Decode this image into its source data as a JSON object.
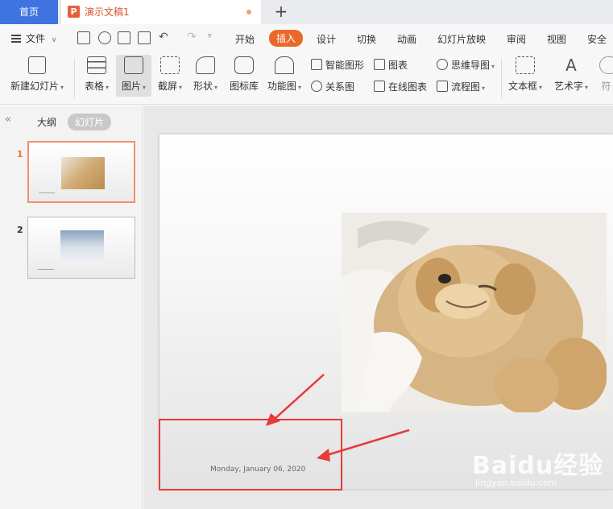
{
  "tabs": {
    "home_label": "首页",
    "doc_icon_glyph": "P",
    "doc_title": "演示文稿1",
    "new_tab_glyph": "+"
  },
  "menu": {
    "file_label": "文件",
    "items": [
      "开始",
      "插入",
      "设计",
      "切换",
      "动画",
      "幻灯片放映",
      "审阅",
      "视图",
      "安全"
    ],
    "active_index": 1,
    "accent_color": "#e9682a"
  },
  "ribbon": {
    "new_slide": "新建幻灯片",
    "table": "表格",
    "picture": "图片",
    "screenshot": "截屏",
    "shape": "形状",
    "icon_lib": "图标库",
    "func_chart": "功能图",
    "smart_shape": "智能图形",
    "chart": "图表",
    "relation": "关系图",
    "online_chart": "在线图表",
    "mindmap": "思维导图",
    "flowchart": "流程图",
    "textbox": "文本框",
    "wordart": "艺术字",
    "symbol_partial": "符"
  },
  "panel": {
    "collapse_glyph": "«",
    "outline_tab": "大纲",
    "slides_tab": "幻灯片",
    "thumbnails": [
      {
        "number": "1",
        "selected": true,
        "image": "sleeping-golden-puppy"
      },
      {
        "number": "2",
        "selected": false,
        "image": "white-fluffy-puppy-in-snow"
      }
    ]
  },
  "slide": {
    "image": "sleeping-golden-puppy-photo",
    "footer_date": "Monday, January 06, 2020"
  },
  "annotation": {
    "highlight_color": "#e83a3a"
  },
  "watermark": {
    "logo": "Baidu经验",
    "url": "jingyan.baidu.com"
  }
}
